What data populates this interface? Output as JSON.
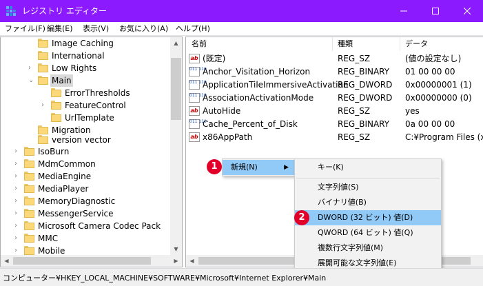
{
  "window": {
    "title": "レジストリ エディター",
    "titlebar_color": "#8c1aff",
    "icon": "registry-editor-icon"
  },
  "menu": [
    "ファイル(F)",
    "編集(E)",
    "表示(V)",
    "お気に入り(A)",
    "ヘルプ(H)"
  ],
  "tree": [
    {
      "label": "Image Caching",
      "depth": 2,
      "expander": ""
    },
    {
      "label": "International",
      "depth": 2,
      "expander": ""
    },
    {
      "label": "Low Rights",
      "depth": 2,
      "expander": ">"
    },
    {
      "label": "Main",
      "depth": 2,
      "expander": "v",
      "selected": true
    },
    {
      "label": "ErrorThresholds",
      "depth": 3,
      "expander": ""
    },
    {
      "label": "FeatureControl",
      "depth": 3,
      "expander": ">"
    },
    {
      "label": "UrlTemplate",
      "depth": 3,
      "expander": ""
    },
    {
      "label": "Migration",
      "depth": 2,
      "expander": ""
    },
    {
      "label": "version vector",
      "depth": 2,
      "expander": ""
    },
    {
      "label": "IsoBurn",
      "depth": 1,
      "expander": ">"
    },
    {
      "label": "MdmCommon",
      "depth": 1,
      "expander": ">"
    },
    {
      "label": "MediaEngine",
      "depth": 1,
      "expander": ">"
    },
    {
      "label": "MediaPlayer",
      "depth": 1,
      "expander": ">"
    },
    {
      "label": "MemoryDiagnostic",
      "depth": 1,
      "expander": ">"
    },
    {
      "label": "MessengerService",
      "depth": 1,
      "expander": ">"
    },
    {
      "label": "Microsoft Camera Codec Pack",
      "depth": 1,
      "expander": ">"
    },
    {
      "label": "MMC",
      "depth": 1,
      "expander": ">"
    },
    {
      "label": "Mobile",
      "depth": 1,
      "expander": ">"
    }
  ],
  "list": {
    "headers": {
      "name": "名前",
      "type": "種類",
      "data": "データ"
    },
    "rows": [
      {
        "icon": "ab",
        "name": "(既定)",
        "type": "REG_SZ",
        "data": "(値の設定なし)"
      },
      {
        "icon": "bin",
        "name": "Anchor_Visitation_Horizon",
        "type": "REG_BINARY",
        "data": "01 00 00 00"
      },
      {
        "icon": "bin",
        "name": "ApplicationTileImmersiveActivation",
        "type": "REG_DWORD",
        "data": "0x00000001 (1)"
      },
      {
        "icon": "bin",
        "name": "AssociationActivationMode",
        "type": "REG_DWORD",
        "data": "0x00000000 (0)"
      },
      {
        "icon": "ab",
        "name": "AutoHide",
        "type": "REG_SZ",
        "data": "yes"
      },
      {
        "icon": "bin",
        "name": "Cache_Percent_of_Disk",
        "type": "REG_BINARY",
        "data": "0a 00 00 00"
      },
      {
        "icon": "ab",
        "name": "x86AppPath",
        "type": "REG_SZ",
        "data": "C:¥Program Files (x86"
      }
    ]
  },
  "context_menu": {
    "new_label": "新規(N)",
    "submenu": [
      "キー(K)",
      "文字列値(S)",
      "バイナリ値(B)",
      "DWORD (32 ビット) 値(D)",
      "QWORD (64 ビット) 値(Q)",
      "複数行文字列値(M)",
      "展開可能な文字列値(E)"
    ],
    "highlight_color": "#91c9f7"
  },
  "badges": [
    "1",
    "2"
  ],
  "badge_color": "#e0002a",
  "status_path": "コンピューター¥HKEY_LOCAL_MACHINE¥SOFTWARE¥Microsoft¥Internet Explorer¥Main"
}
